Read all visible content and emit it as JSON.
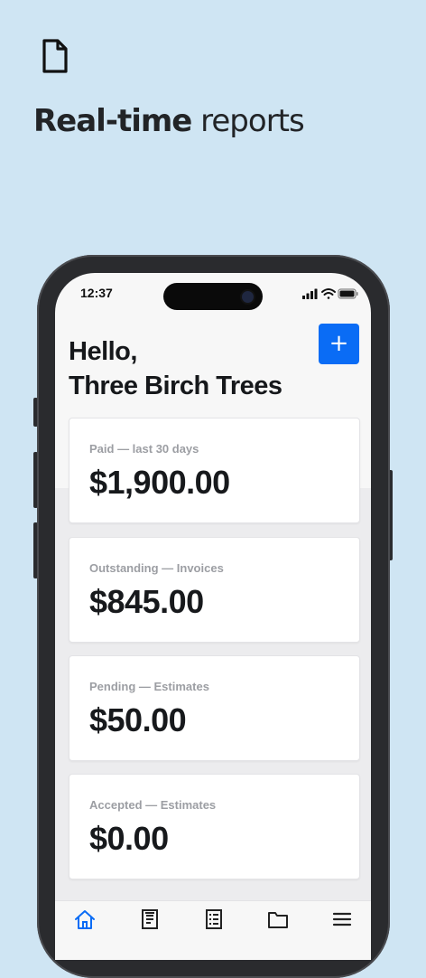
{
  "promo": {
    "icon": "document-icon",
    "headline_bold": "Real-time",
    "headline_rest": "reports"
  },
  "status_bar": {
    "time": "12:37",
    "icons": [
      "signal-icon",
      "wifi-icon",
      "battery-icon"
    ]
  },
  "greeting": {
    "line1": "Hello,",
    "line2": "Three Birch Trees"
  },
  "add_button": {
    "label": "+"
  },
  "cards": [
    {
      "label": "Paid — last 30 days",
      "amount": "$1,900.00"
    },
    {
      "label": "Outstanding — Invoices",
      "amount": "$845.00"
    },
    {
      "label": "Pending — Estimates",
      "amount": "$50.00"
    },
    {
      "label": "Accepted — Estimates",
      "amount": "$0.00"
    }
  ],
  "tabbar": {
    "items": [
      "home-icon",
      "estimates-icon",
      "invoices-icon",
      "folder-icon",
      "menu-icon"
    ],
    "active": "home-icon"
  },
  "colors": {
    "background": "#cfe5f3",
    "accent": "#0a6cf5",
    "label": "#9c9ea3",
    "text": "#17191c"
  }
}
